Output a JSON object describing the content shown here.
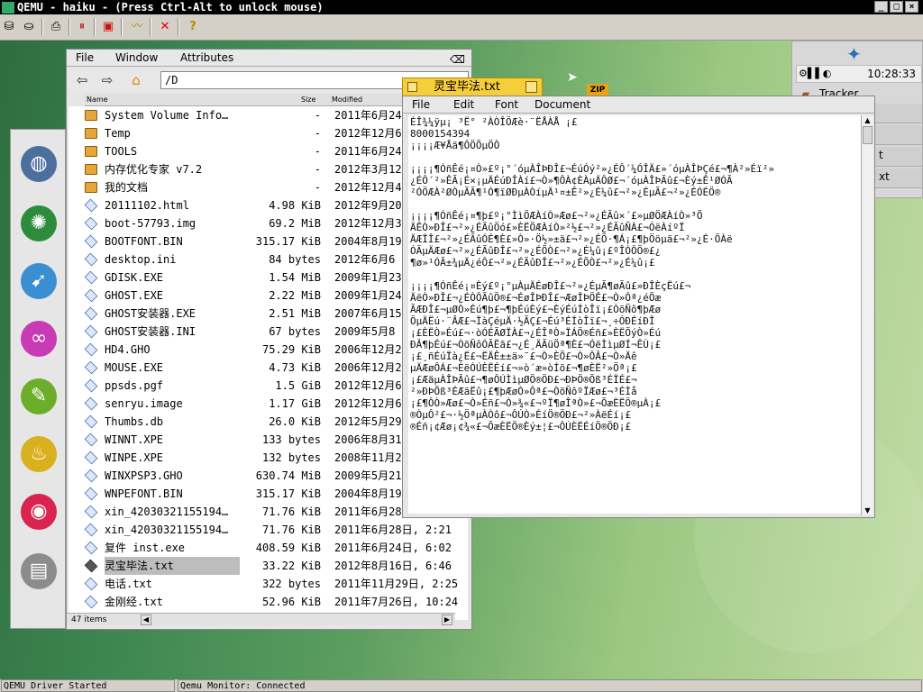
{
  "qemu": {
    "title": "QEMU - haiku - (Press Ctrl-Alt to unlock mouse)",
    "status_left": "QEMU Driver Started",
    "status_right": "Qemu Monitor: Connected"
  },
  "tracker": {
    "time": "10:28:33",
    "label": "Tracker",
    "ext1": "t",
    "ext2": "xt"
  },
  "filewin": {
    "menu": [
      "File",
      "Window",
      "Attributes"
    ],
    "path": "/D",
    "columns": {
      "name": "Name",
      "size": "Size",
      "modified": "Modified"
    },
    "items_count": "47 items",
    "rows": [
      {
        "name": "System Volume Info…",
        "size": "-",
        "date": "2011年6月24",
        "type": "folder"
      },
      {
        "name": "Temp",
        "size": "-",
        "date": "2012年12月6",
        "type": "folder"
      },
      {
        "name": "TOOLS",
        "size": "-",
        "date": "2011年6月24",
        "type": "folder"
      },
      {
        "name": "内存优化专家 v7.2",
        "size": "-",
        "date": "2012年3月12",
        "type": "folder"
      },
      {
        "name": "我的文档",
        "size": "-",
        "date": "2012年12月4",
        "type": "folder"
      },
      {
        "name": "20111102.html",
        "size": "4.98 KiB",
        "date": "2012年9月20",
        "type": "file"
      },
      {
        "name": "boot-57793.img",
        "size": "69.2 MiB",
        "date": "2012年12月3",
        "type": "file"
      },
      {
        "name": "BOOTFONT.BIN",
        "size": "315.17 KiB",
        "date": "2004年8月19",
        "type": "file"
      },
      {
        "name": "desktop.ini",
        "size": "84 bytes",
        "date": "2012年6月6",
        "type": "file"
      },
      {
        "name": "GDISK.EXE",
        "size": "1.54 MiB",
        "date": "2009年1月23",
        "type": "file"
      },
      {
        "name": "GHOST.EXE",
        "size": "2.22 MiB",
        "date": "2009年1月24",
        "type": "file"
      },
      {
        "name": "GHOST安装器.EXE",
        "size": "2.51 MiB",
        "date": "2007年6月15",
        "type": "file"
      },
      {
        "name": "GHOST安装器.INI",
        "size": "67 bytes",
        "date": "2009年5月8",
        "type": "file"
      },
      {
        "name": "HD4.GHO",
        "size": "75.29 KiB",
        "date": "2006年12月2",
        "type": "file"
      },
      {
        "name": "MOUSE.EXE",
        "size": "4.73 KiB",
        "date": "2006年12月2",
        "type": "file"
      },
      {
        "name": "ppsds.pgf",
        "size": "1.5 GiB",
        "date": "2012年12月6",
        "type": "file"
      },
      {
        "name": "senryu.image",
        "size": "1.17 GiB",
        "date": "2012年12月6",
        "type": "file"
      },
      {
        "name": "Thumbs.db",
        "size": "26.0 KiB",
        "date": "2012年5月29",
        "type": "file"
      },
      {
        "name": "WINNT.XPE",
        "size": "133 bytes",
        "date": "2006年8月31",
        "type": "file"
      },
      {
        "name": "WINPE.XPE",
        "size": "132 bytes",
        "date": "2008年11月2",
        "type": "file"
      },
      {
        "name": "WINXPSP3.GHO",
        "size": "630.74 MiB",
        "date": "2009年5月21日,",
        "type": "file"
      },
      {
        "name": "WNPEFONT.BIN",
        "size": "315.17 KiB",
        "date": "2004年8月19日, 12:00",
        "type": "file"
      },
      {
        "name": "xin_42030321155194…",
        "size": "71.76 KiB",
        "date": "2011年6月28日, 2:22",
        "type": "file"
      },
      {
        "name": "xin_42030321155194…",
        "size": "71.76 KiB",
        "date": "2011年6月28日, 2:21",
        "type": "file"
      },
      {
        "name": "复件 inst.exe",
        "size": "408.59 KiB",
        "date": "2011年6月24日, 6:02",
        "type": "file"
      },
      {
        "name": "灵宝毕法.txt",
        "size": "33.22 KiB",
        "date": "2012年8月16日, 6:46",
        "type": "txt",
        "selected": true
      },
      {
        "name": "电话.txt",
        "size": "322 bytes",
        "date": "2011年11月29日, 2:25",
        "type": "file"
      },
      {
        "name": "金刚经.txt",
        "size": "52.96 KiB",
        "date": "2011年7月26日, 10:24",
        "type": "file"
      }
    ]
  },
  "editor": {
    "title": "灵宝毕法.txt",
    "menu": [
      "File",
      "Edit",
      "Font",
      "Document"
    ],
    "lines": [
      "ÉÎ¾¼ÿµ¡ ³Ë° ²ÀÒÎÖÆè·¨ËÅÀÅ ¡£",
      "8000154394",
      "¡¡¡¡Æ¥Åä¶ÔÖÕµÖÔ­",
      "",
      "¡¡¡¡¶ÓñÊé¡¤Ò»£º¡°´óµÀÎÞÐÎ£¬ÉúÓý²»¿ÉÔ´¼ÓÎÄ£»´óµÀÎÞÇé£¬¶À²»Éï²»",
      "¿ÉÔ´²»ÊÃ¡É×¡µÄÉúÐÎÀí£¬Ò»¶ÔÀ¢ÈÀµÄÔØ£¬´óµÀÎÞÃû£¬Èý±Ê¹ØÓÃ",
      "²ÓÖÆÀ²ØÒµÃÃ¶¹Ó¶ïØÐµÀÒíµÄ¹¤±Ê²»¿É¼û£¬²»¿ÉµÃ£¬²»¿ÉÓÉÖ®",
      "",
      "¡¡¡¡¶ÓñÊé¡¤¶þ£º¡°ÌìÖÆÀíÒ»Æø£¬²»¿ÉÃû×´£»µØÖÆÀíÒ»³Õ",
      "ÄÊÒ»ÐÎ£¬²»¿ÉÃûÖó£»ÈËÖÆÀíÒ»²½£¬²»¿ÉÃûÑÀ£¬ÓëÀíºÏ",
      "ÄÆÏÎ£¬²»¿ÉÃûÓÉ¶È£»Ò»·Ö½»±ä£¬²»¿ÉÕ·¶Á¡£¶þÖöµã£¬²»¿É·ÖÀë",
      "ÓÃµÄÆø£¬²»¿ÉÃûÐÎ£¬²»¿ÉÕÒ£¬²»¿É¼û¡£ºÎÒÔÖ®£¿",
      "¶ø»¹ÓÃ±¾µÄ¿éÔ­£¬²»¿ÉÃûÐÎ£¬²»¿ÉÕÒ£¬²»¿É¼û¡£",
      "",
      "¡¡¡¡¶ÓñÊé¡¤Èý£º¡°µÀµÄÉøÐÎ£¬²»¿ÉµÃ¶øÃû£»ÐÎÈçËú£¬",
      "ÄëÒ»ÐÎ£¬¿ÉÒÔÃûÖ®£¬ÉøÎÞÐÎ£¬ÆøÎÞÖÊ£¬Ò»Ôª¿éÕæ",
      "ÃÆÐÎ£¬µØÒ»Éú¶þ£¬¶þÉúÈý£¬ÈýÉúÍòÎï¡£ÒõÑô¶þÆø",
      "ÖµÄËú·¨ÂÆ£¬ÏàÇéµÄ·½ÃÇ£¬Éú³ÉÍòÎï£¬¸÷ÓÐÉíÐÎ",
      "¡£ÈËÒ»Éú£¬·òÓÉÃØÏÀ£¬¿ÉÎªÒ»ÏÁÖ®Éñ£»ÈËÕýÒ»Éú",
      "ÐÂ¶þÉú£¬ÒõÑôÓÃËã£¬¿É¸ÄÃüÖª¶È£¬ÓëÌìµØÍ¬ÊÙ¡£",
      "¡£¸ñÉúÏà¿Ë£¬ËÄÊ±±ä»¯£¬Ò»ÈÕ£¬Ò»ÔÂ£¬Ò»Äê",
      "µÄÆøÔÁ£¬ÈëÓÚÈËÉí£¬»ò´æ»òÍö£¬¶øÈË²»Öª¡£",
      "¡£ÆäµÀÎÞÃû£¬¶øÔÚÌìµØÖ®ÖÐ£¬ÐÞÖ®Õß³ÉÏÉ£¬",
      "²»ÐÞÕß³ÉÆäËû¡£¶þÆøÒ»Ôª£¬ÒõÑôºÏÆø£¬³ÉÌå",
      "¡£¶ÔÒ»Æø£¬Ò»Éñ£¬Ò»¾«£¬ºÏ¶øÎªÒ»£¬ÕæÈËÖ®µÀ¡£",
      "®ÒµÔ²£¬·½ÖªµÀÒô£¬ÔÚÒ»ÉíÖ®ÖÐ£¬²»ÀëÉí¡£",
      "®Éñ¡¢Æø¡¢¾«£¬ÕæÈËÖ®Èý±¦£¬ÔÚÈËÉíÖ®ÖÐ¡£"
    ]
  }
}
